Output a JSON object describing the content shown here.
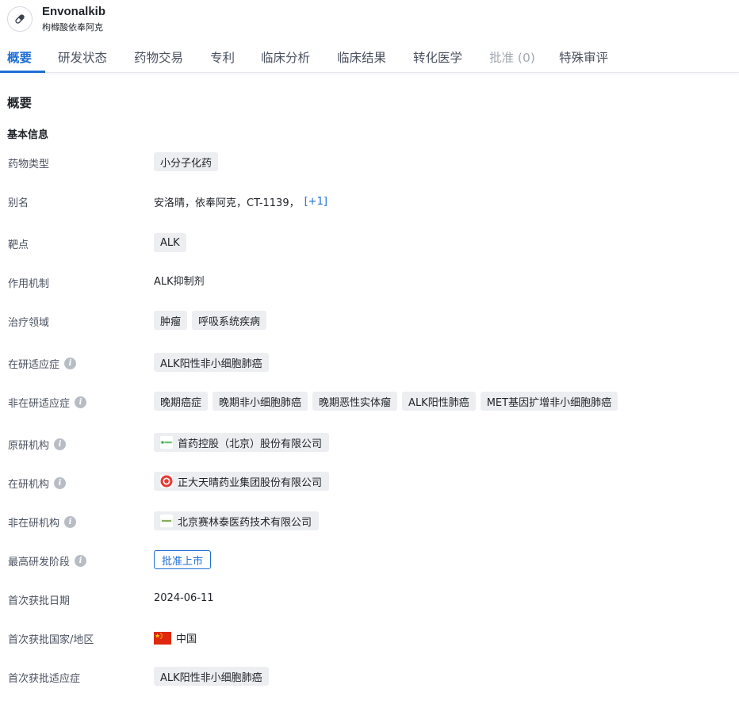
{
  "header": {
    "icon": "pill-icon",
    "title": "Envonalkib",
    "subtitle": "枸橼酸依奉阿克"
  },
  "tabs": [
    {
      "label": "概要",
      "state": "active"
    },
    {
      "label": "研发状态",
      "state": "normal"
    },
    {
      "label": "药物交易",
      "state": "normal"
    },
    {
      "label": "专利",
      "state": "normal"
    },
    {
      "label": "临床分析",
      "state": "normal"
    },
    {
      "label": "临床结果",
      "state": "normal"
    },
    {
      "label": "转化医学",
      "state": "normal"
    },
    {
      "label": "批准 (0)",
      "state": "disabled"
    },
    {
      "label": "特殊审评",
      "state": "normal"
    }
  ],
  "section_title": "概要",
  "subsection_title": "基本信息",
  "rows": {
    "drug_type": {
      "label": "药物类型",
      "tags": [
        "小分子化药"
      ]
    },
    "alias": {
      "label": "别名",
      "text": "安洛晴，依奉阿克，CT-1139，",
      "more": "[+1]"
    },
    "target": {
      "label": "靶点",
      "tags": [
        "ALK"
      ]
    },
    "mechanism": {
      "label": "作用机制",
      "text": "ALK抑制剂"
    },
    "therapeutic_area": {
      "label": "治疗领域",
      "tags": [
        "肿瘤",
        "呼吸系统疾病"
      ]
    },
    "active_indication": {
      "label": "在研适应症",
      "tags": [
        "ALK阳性非小细胞肺癌"
      ]
    },
    "inactive_indication": {
      "label": "非在研适应症",
      "tags": [
        "晚期癌症",
        "晚期非小细胞肺癌",
        "晚期恶性实体瘤",
        "ALK阳性肺癌",
        "MET基因扩增非小细胞肺癌"
      ]
    },
    "originator": {
      "label": "原研机构",
      "org": "首药控股（北京）股份有限公司",
      "logo": "shouyao-logo-icon"
    },
    "active_org": {
      "label": "在研机构",
      "org": "正大天晴药业集团股份有限公司",
      "logo": "chiatai-tianqing-logo-icon"
    },
    "inactive_org": {
      "label": "非在研机构",
      "org": "北京赛林泰医药技术有限公司",
      "logo": "sailintai-logo-icon"
    },
    "highest_phase": {
      "label": "最高研发阶段",
      "status": "批准上市"
    },
    "first_approval_date": {
      "label": "首次获批日期",
      "text": "2024-06-11"
    },
    "first_approval_region": {
      "label": "首次获批国家/地区",
      "text": "中国",
      "flag": "china-flag-icon"
    },
    "first_approval_indication": {
      "label": "首次获批适应症",
      "tags": [
        "ALK阳性非小细胞肺癌"
      ]
    }
  },
  "colors": {
    "accent": "#1f6fd6",
    "tag_bg": "#eceef1",
    "label_text": "#4a5260",
    "disabled_tab": "#a3a8b0"
  }
}
